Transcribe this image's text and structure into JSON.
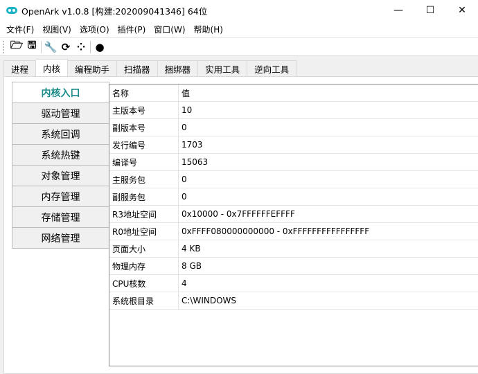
{
  "window": {
    "title": "OpenArk v1.0.8  [构建:202009041346]  64位",
    "minimize": "—",
    "maximize": "☐",
    "close": "✕"
  },
  "menu": [
    "文件(F)",
    "视图(V)",
    "选项(O)",
    "插件(P)",
    "窗口(W)",
    "帮助(H)"
  ],
  "toolbar": [
    {
      "icon": "folder-open-icon",
      "glyph": "🗁"
    },
    {
      "icon": "save-icon",
      "glyph": "🖫"
    },
    {
      "icon": "wrench-icon",
      "glyph": "🔧"
    },
    {
      "icon": "refresh-icon",
      "glyph": "⟳"
    },
    {
      "icon": "grid-icon",
      "glyph": "⁘"
    },
    {
      "icon": "github-icon",
      "glyph": "●"
    }
  ],
  "tabs": [
    "进程",
    "内核",
    "编程助手",
    "扫描器",
    "捆绑器",
    "实用工具",
    "逆向工具"
  ],
  "active_tab": 1,
  "sidebar": [
    "内核入口",
    "驱动管理",
    "系统回调",
    "系统热键",
    "对象管理",
    "内存管理",
    "存储管理",
    "网络管理"
  ],
  "table": {
    "headers": [
      "名称",
      "值"
    ],
    "rows": [
      [
        "主版本号",
        "10"
      ],
      [
        "副版本号",
        "0"
      ],
      [
        "发行编号",
        "1703"
      ],
      [
        "编译号",
        "15063"
      ],
      [
        "主服务包",
        "0"
      ],
      [
        "副服务包",
        "0"
      ],
      [
        "R3地址空间",
        "0x10000 - 0x7FFFFFFEFFFF"
      ],
      [
        "R0地址空间",
        "0xFFFF080000000000 - 0xFFFFFFFFFFFFFFFF"
      ],
      [
        "页面大小",
        "4 KB"
      ],
      [
        "物理内存",
        "8 GB"
      ],
      [
        "CPU核数",
        "4"
      ],
      [
        "系统根目录",
        "C:\\WINDOWS"
      ]
    ]
  }
}
